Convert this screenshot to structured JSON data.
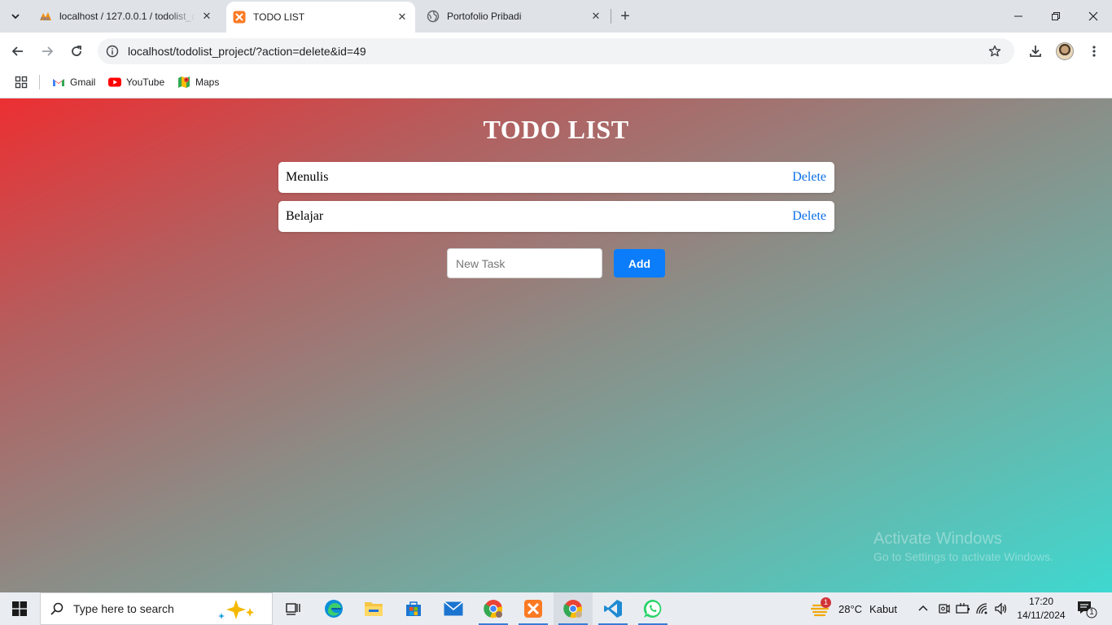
{
  "browser": {
    "tabs": [
      {
        "title": "localhost / 127.0.0.1 / todolist_d",
        "icon": "phpmyadmin-icon",
        "active": false
      },
      {
        "title": "TODO LIST",
        "icon": "xampp-icon",
        "active": true
      },
      {
        "title": "Portofolio Pribadi",
        "icon": "globe-icon",
        "active": false
      }
    ],
    "url": "localhost/todolist_project/?action=delete&id=49",
    "bookmarks": [
      {
        "label": "Gmail",
        "icon": "gmail-icon"
      },
      {
        "label": "YouTube",
        "icon": "youtube-icon"
      },
      {
        "label": "Maps",
        "icon": "maps-icon"
      }
    ]
  },
  "page": {
    "title": "TODO LIST",
    "tasks": [
      {
        "text": "Menulis",
        "action": "Delete"
      },
      {
        "text": "Belajar",
        "action": "Delete"
      }
    ],
    "new_task_placeholder": "New Task",
    "add_button": "Add",
    "accent_color": "#0b7dfb",
    "gradient_colors": [
      "#ec2f32",
      "#3ed8d0"
    ]
  },
  "watermark": {
    "line1": "Activate Windows",
    "line2": "Go to Settings to activate Windows."
  },
  "taskbar": {
    "search_placeholder": "Type here to search",
    "apps": [
      "task-view-icon",
      "edge-icon",
      "file-explorer-icon",
      "store-icon",
      "mail-icon",
      "chrome-icon",
      "xampp-icon",
      "chrome-profile-icon",
      "vscode-icon",
      "whatsapp-icon"
    ],
    "weather": {
      "temp": "28°C",
      "condition": "Kabut",
      "badge": "1"
    },
    "time": "17:20",
    "date": "14/11/2024",
    "notification_count": "1"
  }
}
